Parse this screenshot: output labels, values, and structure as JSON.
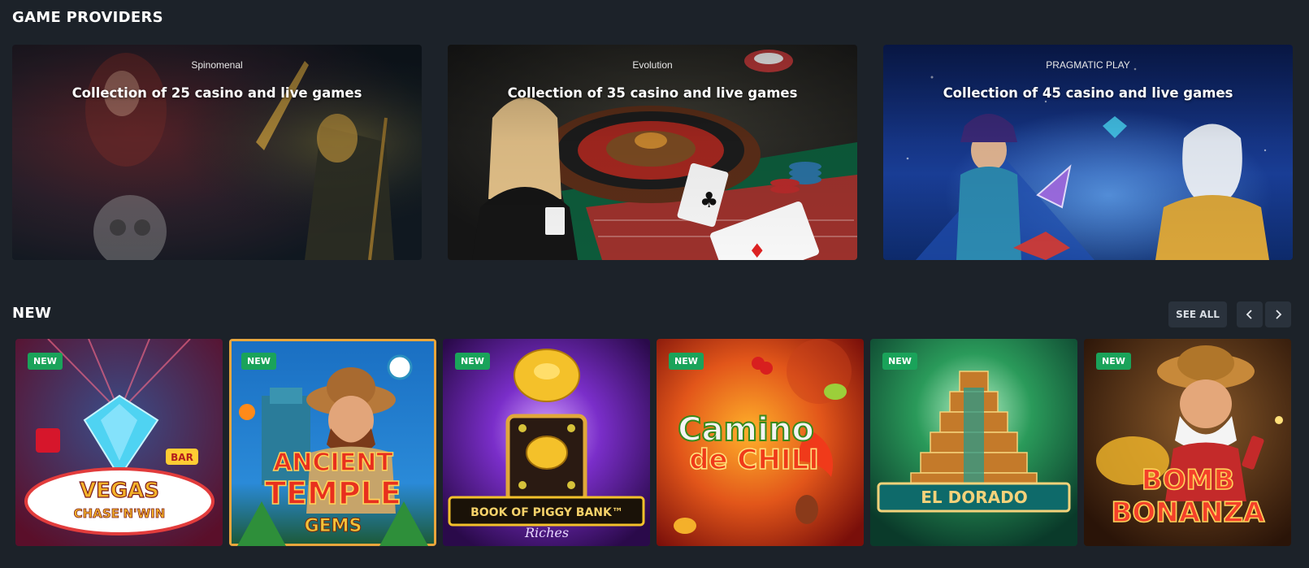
{
  "sections": {
    "providers_title": "GAME PROVIDERS",
    "new_title": "NEW"
  },
  "providers": [
    {
      "logo": "Spinomenal",
      "description": "Collection of 25 casino and live games"
    },
    {
      "logo": "Evolution",
      "description": "Collection of 35 casino and live games"
    },
    {
      "logo": "PRAGMATIC PLAY",
      "description": "Collection of 45 casino and live games"
    }
  ],
  "controls": {
    "see_all": "SEE ALL",
    "prev_icon": "chevron-left-icon",
    "next_icon": "chevron-right-icon"
  },
  "games": [
    {
      "badge": "NEW",
      "title_line1": "VEGAS",
      "title_line2": "CHASE'N'WIN",
      "selected": false
    },
    {
      "badge": "NEW",
      "title_line1": "ANCIENT",
      "title_line2": "TEMPLE",
      "title_line3": "GEMS",
      "selected": true
    },
    {
      "badge": "NEW",
      "title_line1": "BOOK OF PIGGY BANK™",
      "title_line2": "Riches",
      "selected": false
    },
    {
      "badge": "NEW",
      "title_line1": "Camino",
      "title_line2": "de CHILI",
      "selected": false
    },
    {
      "badge": "NEW",
      "title_line1": "EL DORADO",
      "selected": false
    },
    {
      "badge": "NEW",
      "title_line1": "BOMB",
      "title_line2": "BONANZA",
      "selected": false
    }
  ],
  "colors": {
    "background": "#1c2229",
    "button_bg": "#2a323c",
    "new_badge": "#1aa35a",
    "selected_outline": "#e8a63c"
  }
}
